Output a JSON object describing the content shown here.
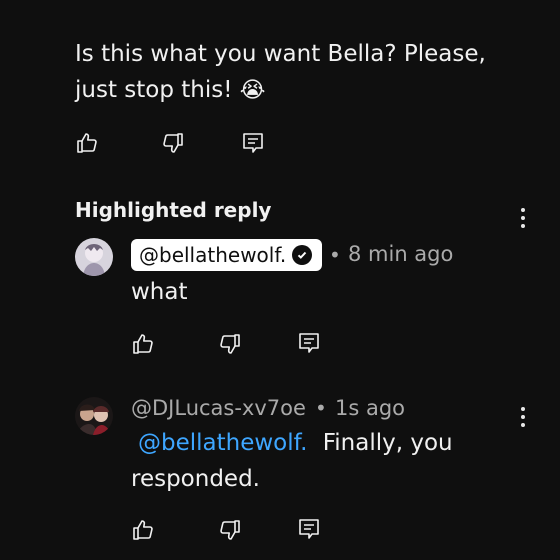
{
  "main_comment": {
    "text_line1": "Is this what you want Bella? Please,",
    "text_line2": "just stop this!",
    "emoji": "😭"
  },
  "highlighted_label": "Highlighted reply",
  "reply1": {
    "author": "@bellathewolf.",
    "time": "8 min ago",
    "text": "what"
  },
  "reply2": {
    "author": "@DJLucas-xv7oe",
    "time": "1s ago",
    "mention": "@bellathewolf.",
    "text_after_mention": "Finally, you",
    "text_line2": "responded."
  },
  "separator": "•",
  "icons": {
    "like": "thumbs-up-icon",
    "dislike": "thumbs-down-icon",
    "reply": "reply-comment-icon",
    "menu": "more-vert-icon",
    "verified": "verified-check-icon"
  },
  "colors": {
    "background": "#0f0f0f",
    "text": "#f1f1f1",
    "secondary": "#aaaaaa",
    "mention": "#3ea6ff"
  }
}
